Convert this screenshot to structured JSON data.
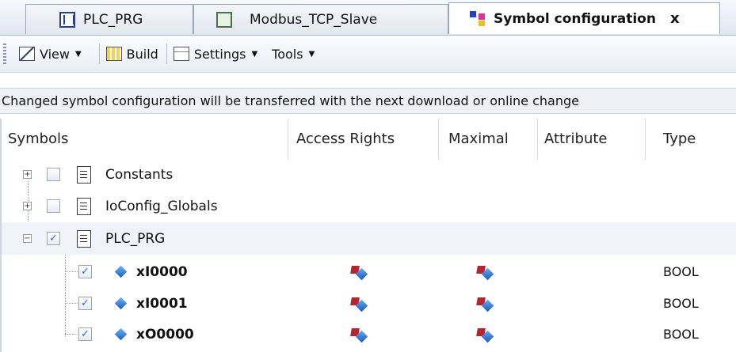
{
  "tabs": [
    {
      "label": "PLC_PRG",
      "icon": "plc-prg-icon"
    },
    {
      "label": "Modbus_TCP_Slave",
      "icon": "modbus-device-icon"
    },
    {
      "label": "Symbol configuration",
      "icon": "symbol-configuration-icon",
      "active": true,
      "close": "x"
    }
  ],
  "toolbar": {
    "view_label": "View",
    "build_label": "Build",
    "settings_label": "Settings",
    "tools_label": "Tools"
  },
  "info_message": "Changed symbol configuration will be transferred with the next download or online change",
  "columns": {
    "symbols": "Symbols",
    "access_rights": "Access Rights",
    "maximal": "Maximal",
    "attribute": "Attribute",
    "type": "Type"
  },
  "rows": [
    {
      "name": "Constants",
      "expander": "+",
      "checked": false
    },
    {
      "name": "IoConfig_Globals",
      "expander": "+",
      "checked": false
    },
    {
      "name": "PLC_PRG",
      "expander": "−",
      "checked": true
    },
    {
      "name": "xI0000",
      "checked": true,
      "type": "BOOL"
    },
    {
      "name": "xI0001",
      "checked": true,
      "type": "BOOL"
    },
    {
      "name": "xO0000",
      "checked": true,
      "type": "BOOL"
    }
  ],
  "colors": {
    "accent": "#2a6bd6",
    "rights_red": "#b3262f",
    "rights_blue": "#1a5ab5"
  }
}
